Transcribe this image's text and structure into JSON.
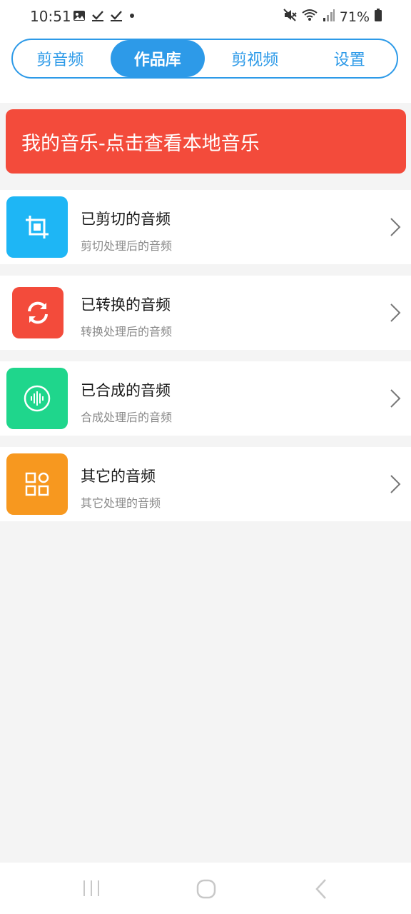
{
  "status_bar": {
    "time": "10:51",
    "battery": "71%",
    "left_icons": [
      "image-icon",
      "check-icon",
      "check-icon",
      "dot-icon"
    ],
    "right_icons": [
      "mute-icon",
      "wifi-icon",
      "signal-icon",
      "battery-icon"
    ]
  },
  "tabs": [
    {
      "label": "剪音频",
      "active": false
    },
    {
      "label": "作品库",
      "active": true
    },
    {
      "label": "剪视频",
      "active": false
    },
    {
      "label": "设置",
      "active": false
    }
  ],
  "banner": {
    "text": "我的音乐-点击查看本地音乐",
    "color": "#f34b3b"
  },
  "items": [
    {
      "title": "已剪切的音频",
      "subtitle": "剪切处理后的音频",
      "icon": "crop-icon",
      "color": "#1eb6f5"
    },
    {
      "title": "已转换的音频",
      "subtitle": "转换处理后的音频",
      "icon": "refresh-icon",
      "color": "#f34b3b"
    },
    {
      "title": "已合成的音频",
      "subtitle": "合成处理后的音频",
      "icon": "waveform-icon",
      "color": "#1fd68c"
    },
    {
      "title": "其它的音频",
      "subtitle": "其它处理的音频",
      "icon": "grid-icon",
      "color": "#f7981f"
    }
  ],
  "nav": [
    "recents-icon",
    "home-icon",
    "back-icon"
  ],
  "colors": {
    "accent": "#2d9ae8",
    "background": "#f4f4f4"
  }
}
